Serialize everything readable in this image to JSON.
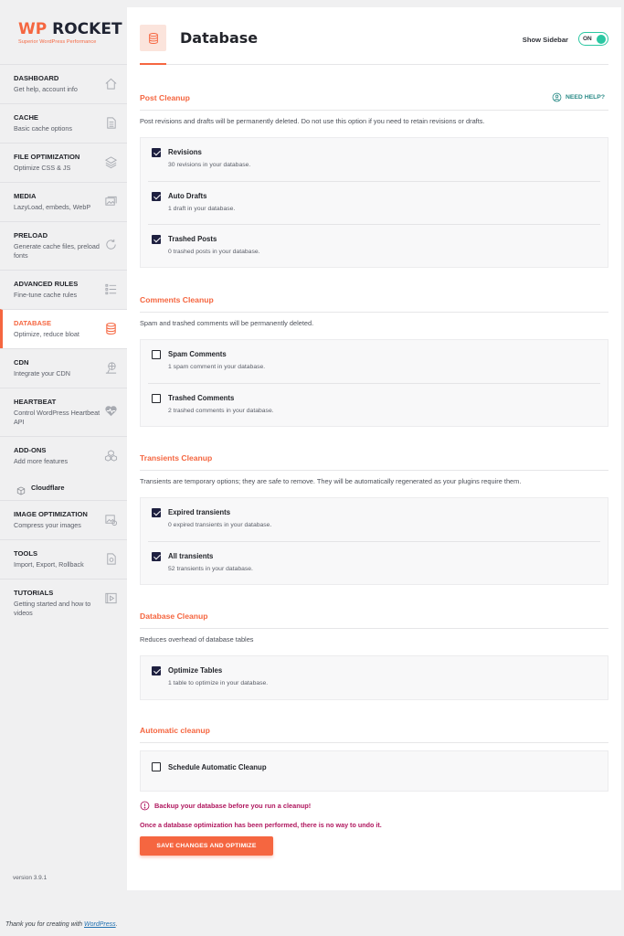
{
  "logo": {
    "wp": "WP",
    "rocket": "ROCKET",
    "tagline": "Superior WordPress Performance"
  },
  "nav": [
    {
      "id": "dashboard",
      "title": "DASHBOARD",
      "desc": "Get help, account info",
      "icon": "home-icon"
    },
    {
      "id": "cache",
      "title": "CACHE",
      "desc": "Basic cache options",
      "icon": "file-icon"
    },
    {
      "id": "file-optimization",
      "title": "FILE OPTIMIZATION",
      "desc": "Optimize CSS & JS",
      "icon": "layers-icon"
    },
    {
      "id": "media",
      "title": "MEDIA",
      "desc": "LazyLoad, embeds, WebP",
      "icon": "images-icon"
    },
    {
      "id": "preload",
      "title": "PRELOAD",
      "desc": "Generate cache files, preload fonts",
      "icon": "refresh-icon"
    },
    {
      "id": "advanced-rules",
      "title": "ADVANCED RULES",
      "desc": "Fine-tune cache rules",
      "icon": "list-icon"
    },
    {
      "id": "database",
      "title": "DATABASE",
      "desc": "Optimize, reduce bloat",
      "icon": "database-icon",
      "active": true
    },
    {
      "id": "cdn",
      "title": "CDN",
      "desc": "Integrate your CDN",
      "icon": "cdn-icon"
    },
    {
      "id": "heartbeat",
      "title": "HEARTBEAT",
      "desc": "Control WordPress Heartbeat API",
      "icon": "heart-icon"
    },
    {
      "id": "add-ons",
      "title": "ADD-ONS",
      "desc": "Add more features",
      "icon": "cubes-icon"
    },
    {
      "id": "image-optimization",
      "title": "IMAGE OPTIMIZATION",
      "desc": "Compress your images",
      "icon": "image-compress-icon"
    },
    {
      "id": "tools",
      "title": "TOOLS",
      "desc": "Import, Export, Rollback",
      "icon": "tools-icon"
    },
    {
      "id": "tutorials",
      "title": "TUTORIALS",
      "desc": "Getting started and how to videos",
      "icon": "video-icon"
    }
  ],
  "nav_sub": {
    "cloudflare": "Cloudflare"
  },
  "version": "version 3.9.1",
  "header": {
    "title": "Database",
    "show_sidebar_label": "Show Sidebar",
    "toggle_state": "ON"
  },
  "help_label": "NEED HELP?",
  "sections": {
    "post": {
      "title": "Post Cleanup",
      "desc": "Post revisions and drafts will be permanently deleted. Do not use this option if you need to retain revisions or drafts.",
      "options": [
        {
          "label": "Revisions",
          "desc": "30 revisions in your database.",
          "checked": true
        },
        {
          "label": "Auto Drafts",
          "desc": "1 draft in your database.",
          "checked": true
        },
        {
          "label": "Trashed Posts",
          "desc": "0 trashed posts in your database.",
          "checked": true
        }
      ]
    },
    "comments": {
      "title": "Comments Cleanup",
      "desc": "Spam and trashed comments will be permanently deleted.",
      "options": [
        {
          "label": "Spam Comments",
          "desc": "1 spam comment in your database.",
          "checked": false
        },
        {
          "label": "Trashed Comments",
          "desc": "2 trashed comments in your database.",
          "checked": false
        }
      ]
    },
    "transients": {
      "title": "Transients Cleanup",
      "desc": "Transients are temporary options; they are safe to remove. They will be automatically regenerated as your plugins require them.",
      "options": [
        {
          "label": "Expired transients",
          "desc": "0 expired transients in your database.",
          "checked": true
        },
        {
          "label": "All transients",
          "desc": "52 transients in your database.",
          "checked": true
        }
      ]
    },
    "database": {
      "title": "Database Cleanup",
      "desc": "Reduces overhead of database tables",
      "options": [
        {
          "label": "Optimize Tables",
          "desc": "1 table to optimize in your database.",
          "checked": true
        }
      ]
    },
    "automatic": {
      "title": "Automatic cleanup",
      "options": [
        {
          "label": "Schedule Automatic Cleanup",
          "checked": false
        }
      ]
    }
  },
  "warning": "Backup your database before you run a cleanup!",
  "warning_note": "Once a database optimization has been performed, there is no way to undo it.",
  "save_button": "SAVE CHANGES AND OPTIMIZE",
  "footer": {
    "text": "Thank you for creating with ",
    "link": "WordPress",
    "end": "."
  },
  "colors": {
    "accent": "#f56640",
    "toggle": "#2bc7a2",
    "warning": "#b0185f",
    "help": "#2a8b87",
    "checkbox": "#1e2040"
  }
}
